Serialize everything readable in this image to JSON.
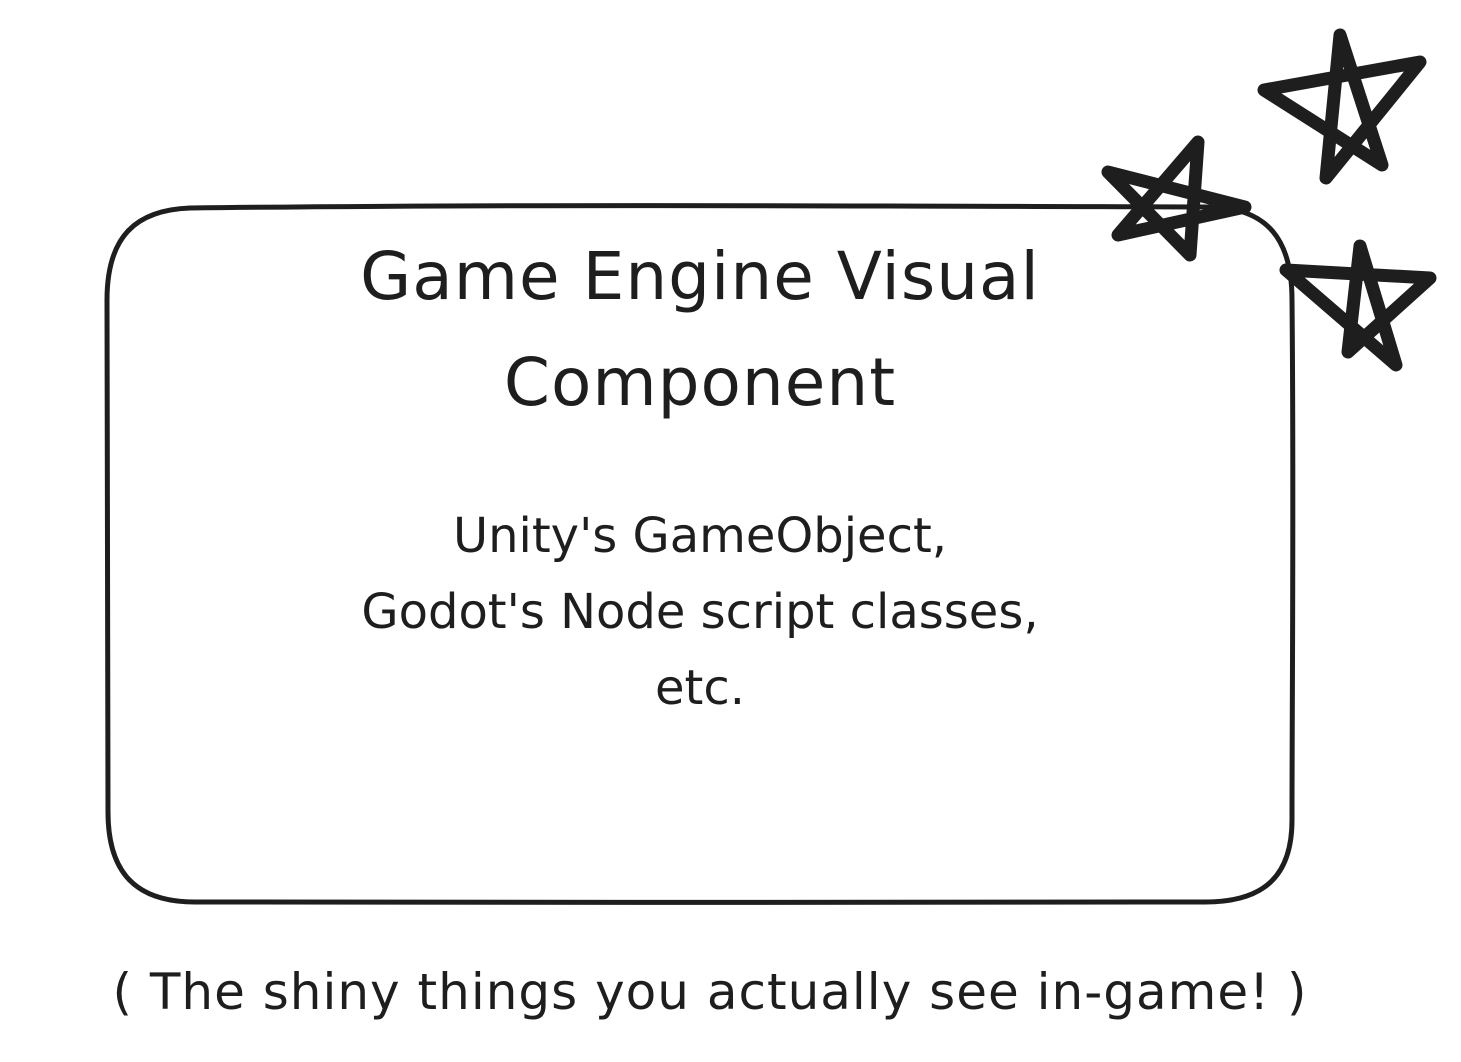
{
  "diagram": {
    "title": "Game Engine Visual\nComponent",
    "body": "Unity's GameObject,\nGodot's Node script classes,\netc.",
    "caption": "( The shiny things you actually see in-game! )"
  },
  "colors": {
    "stroke": "#1e1e1e",
    "background": "#ffffff"
  },
  "icons": [
    "star-icon",
    "star-icon",
    "star-icon"
  ]
}
